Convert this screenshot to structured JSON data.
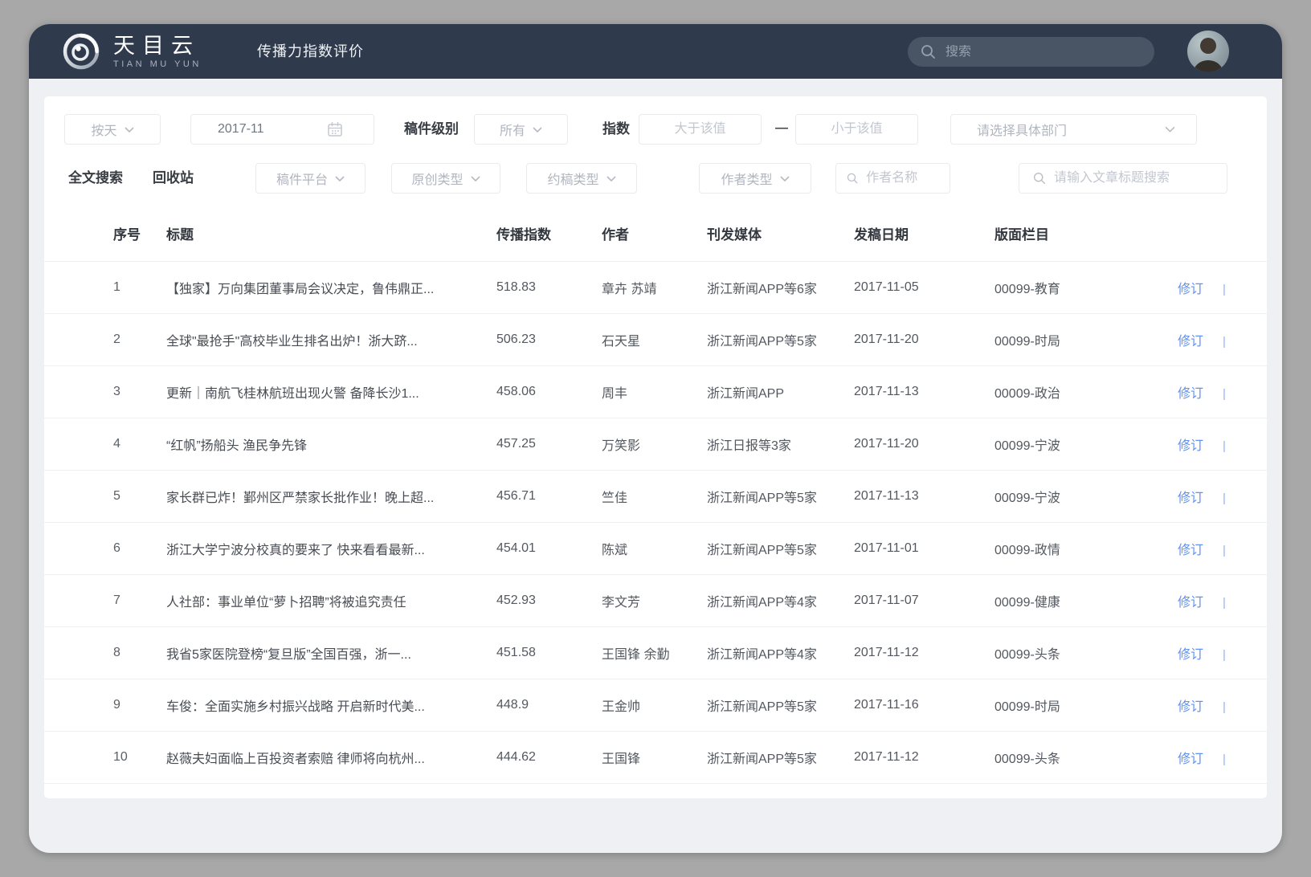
{
  "theme": {
    "header_bg": "#2f3b4d",
    "accent_blue": "#6191f2"
  },
  "header": {
    "logo_title": "天目云",
    "logo_subtitle": "TIAN MU YUN",
    "page_title": "传播力指数评价",
    "search_placeholder": "搜索"
  },
  "icons": {
    "logo": "swirl-logo-icon",
    "top_search": "search-icon",
    "calendar": "calendar-icon",
    "dropdown": "chevron-down-icon",
    "field_search": "search-icon"
  },
  "filters": {
    "row1": {
      "time_mode_value": "按天",
      "month_value": "2017-11",
      "level_label": "稿件级别",
      "level_value": "所有",
      "index_label": "指数",
      "index_min_placeholder": "大于该值",
      "range_dash": "—",
      "index_max_placeholder": "小于该值",
      "department_placeholder": "请选择具体部门"
    },
    "row2": {
      "fulltext_label": "全文搜索",
      "recycle_label": "回收站",
      "platform_placeholder": "稿件平台",
      "original_placeholder": "原创类型",
      "commission_placeholder": "约稿类型",
      "author_type_placeholder": "作者类型",
      "author_name_placeholder": "作者名称",
      "title_search_placeholder": "请输入文章标题搜索"
    }
  },
  "table": {
    "columns": [
      "序号",
      "标题",
      "传播指数",
      "作者",
      "刊发媒体",
      "发稿日期",
      "版面栏目"
    ],
    "action_label": "修订",
    "action_divider": "|",
    "rows": [
      {
        "no": "1",
        "title": "【独家】万向集团董事局会议决定，鲁伟鼎正...",
        "index": "518.83",
        "author": "章卉 苏靖",
        "media": "浙江新闻APP等6家",
        "date": "2017-11-05",
        "column": "00099-教育"
      },
      {
        "no": "2",
        "title": "全球\"最抢手\"高校毕业生排名出炉！浙大跻...",
        "index": "506.23",
        "author": "石天星",
        "media": "浙江新闻APP等5家",
        "date": "2017-11-20",
        "column": "00099-时局"
      },
      {
        "no": "3",
        "title": "更新｜南航飞桂林航班出现火警 备降长沙1...",
        "index": "458.06",
        "author": "周丰",
        "media": "浙江新闻APP",
        "date": "2017-11-13",
        "column": "00009-政治"
      },
      {
        "no": "4",
        "title": "“红帆”扬船头 渔民争先锋",
        "index": "457.25",
        "author": "万笑影",
        "media": "浙江日报等3家",
        "date": "2017-11-20",
        "column": "00099-宁波"
      },
      {
        "no": "5",
        "title": "家长群已炸！鄞州区严禁家长批作业！晚上超...",
        "index": "456.71",
        "author": "竺佳",
        "media": "浙江新闻APP等5家",
        "date": "2017-11-13",
        "column": "00099-宁波"
      },
      {
        "no": "6",
        "title": "浙江大学宁波分校真的要来了 快来看看最新...",
        "index": "454.01",
        "author": "陈斌",
        "media": "浙江新闻APP等5家",
        "date": "2017-11-01",
        "column": "00099-政情"
      },
      {
        "no": "7",
        "title": "人社部：事业单位“萝卜招聘”将被追究责任",
        "index": "452.93",
        "author": "李文芳",
        "media": "浙江新闻APP等4家",
        "date": "2017-11-07",
        "column": "00099-健康"
      },
      {
        "no": "8",
        "title": "我省5家医院登榜“复旦版”全国百强，浙一...",
        "index": "451.58",
        "author": "王国锋 余勤",
        "media": "浙江新闻APP等4家",
        "date": "2017-11-12",
        "column": "00099-头条"
      },
      {
        "no": "9",
        "title": "车俊：全面实施乡村振兴战略 开启新时代美...",
        "index": "448.9",
        "author": "王金帅",
        "media": "浙江新闻APP等5家",
        "date": "2017-11-16",
        "column": "00099-时局"
      },
      {
        "no": "10",
        "title": "赵薇夫妇面临上百投资者索赔 律师将向杭州...",
        "index": "444.62",
        "author": "王国锋",
        "media": "浙江新闻APP等5家",
        "date": "2017-11-12",
        "column": "00099-头条"
      }
    ]
  }
}
